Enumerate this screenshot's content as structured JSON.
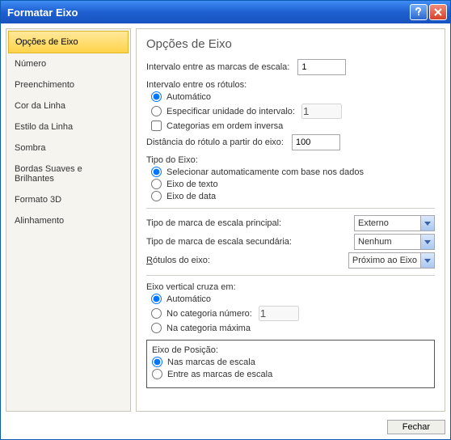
{
  "window": {
    "title": "Formatar Eixo"
  },
  "sidebar": {
    "items": [
      {
        "label": "Opções de Eixo",
        "selected": true
      },
      {
        "label": "Número"
      },
      {
        "label": "Preenchimento"
      },
      {
        "label": "Cor da Linha"
      },
      {
        "label": "Estilo da Linha"
      },
      {
        "label": "Sombra"
      },
      {
        "label": "Bordas Suaves e Brilhantes"
      },
      {
        "label": "Formato 3D"
      },
      {
        "label": "Alinhamento"
      }
    ]
  },
  "panel": {
    "heading": "Opções de Eixo",
    "interval_marks": {
      "label": "Intervalo entre as marcas de escala:",
      "value": "1"
    },
    "interval_labels": {
      "label": "Intervalo entre os rótulos:",
      "auto": {
        "label": "Automático",
        "checked": true
      },
      "specify": {
        "label": "Especificar unidade do intervalo:",
        "value": "1",
        "checked": false
      }
    },
    "reverse": {
      "label": "Categorias em ordem inversa",
      "checked": false
    },
    "label_distance": {
      "label": "Distância do rótulo a partir do eixo:",
      "value": "100"
    },
    "axis_type": {
      "label": "Tipo do Eixo:",
      "options": [
        {
          "label": "Selecionar automaticamente com base nos dados",
          "checked": true
        },
        {
          "label": "Eixo de texto",
          "checked": false
        },
        {
          "label": "Eixo de data",
          "checked": false
        }
      ]
    },
    "major_tick": {
      "label": "Tipo de marca de escala principal:",
      "value": "Externo"
    },
    "minor_tick": {
      "label": "Tipo de marca de escala secundária:",
      "value": "Nenhum"
    },
    "axis_labels": {
      "label": "Rótulos do eixo:",
      "value": "Próximo ao Eixo"
    },
    "cross": {
      "label": "Eixo vertical cruza em:",
      "options": [
        {
          "label": "Automático",
          "checked": true
        },
        {
          "label": "No categoria número:",
          "value": "1",
          "checked": false
        },
        {
          "label": "Na categoria máxima",
          "checked": false
        }
      ]
    },
    "position": {
      "label": "Eixo de Posição:",
      "options": [
        {
          "label": "Nas marcas de escala",
          "checked": true
        },
        {
          "label": "Entre as marcas de escala",
          "checked": false
        }
      ]
    }
  },
  "footer": {
    "close": "Fechar"
  }
}
